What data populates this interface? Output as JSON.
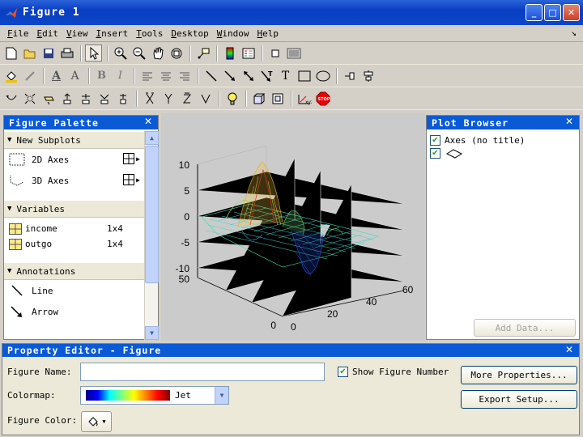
{
  "window": {
    "title": "Figure 1"
  },
  "menu": [
    "File",
    "Edit",
    "View",
    "Insert",
    "Tools",
    "Desktop",
    "Window",
    "Help"
  ],
  "menu_underline": [
    "F",
    "E",
    "V",
    "I",
    "T",
    "D",
    "W",
    "H"
  ],
  "menu_rest": [
    "ile",
    "dit",
    "iew",
    "nsert",
    "ools",
    "esktop",
    "indow",
    "elp"
  ],
  "palette": {
    "title": "Figure Palette",
    "sections": {
      "subplots": "New Subplots",
      "variables": "Variables",
      "annotations": "Annotations"
    },
    "subplots": [
      "2D Axes",
      "3D Axes"
    ],
    "variables": [
      {
        "name": "income",
        "size": "1x4"
      },
      {
        "name": "outgo",
        "size": "1x4"
      }
    ],
    "annotations": [
      "Line",
      "Arrow"
    ]
  },
  "plot": {
    "z_ticks": [
      "10",
      "5",
      "0",
      "-5",
      "-10"
    ],
    "y_ticks": [
      "50",
      "0"
    ],
    "x_ticks": [
      "0",
      "20",
      "40",
      "60"
    ]
  },
  "browser": {
    "title": "Plot Browser",
    "axes_label": "Axes (no title)",
    "add_data": "Add Data..."
  },
  "property_editor": {
    "title": "Property Editor - Figure",
    "figure_name_label": "Figure Name:",
    "figure_name_value": "",
    "show_number_label": "Show Figure Number",
    "colormap_label": "Colormap:",
    "colormap_value": "Jet",
    "figure_color_label": "Figure Color:",
    "more_properties": "More Properties...",
    "export_setup": "Export Setup..."
  }
}
